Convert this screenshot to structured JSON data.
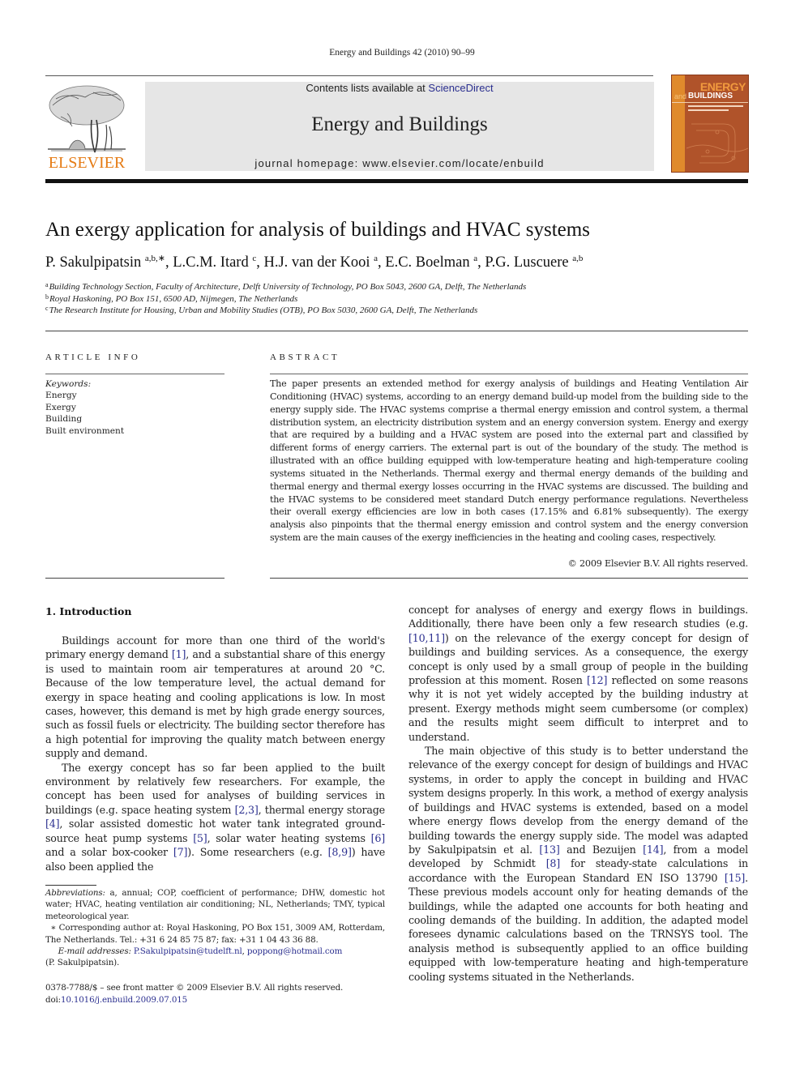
{
  "running_head": "Energy and Buildings 42 (2010) 90–99",
  "masthead": {
    "publisher_logo_text": "ELSEVIER",
    "contents_prefix": "Contents lists available at ",
    "contents_link": "ScienceDirect",
    "journal_name": "Energy and Buildings",
    "homepage_line": "journal homepage: www.elsevier.com/locate/enbuild",
    "cover": {
      "title_top": "ENERGY",
      "title_and": "and",
      "title_bottom": "BUILDINGS",
      "colors": {
        "background": "#b0532a",
        "stripe": "#e08a2c",
        "title": "#f19a3e"
      }
    },
    "colors": {
      "elsevier_orange": "#e57b14",
      "box_gray": "#e6e6e6",
      "link_blue": "#2b2f8f"
    }
  },
  "article": {
    "title": "An exergy application for analysis of buildings and HVAC systems",
    "authors": [
      {
        "name": "P. Sakulpipatsin",
        "sup": "a,b,∗"
      },
      {
        "name": "L.C.M. Itard",
        "sup": "c"
      },
      {
        "name": "H.J. van der Kooi",
        "sup": "a"
      },
      {
        "name": "E.C. Boelman",
        "sup": "a"
      },
      {
        "name": "P.G. Luscuere",
        "sup": "a,b"
      }
    ],
    "author_separator": ", ",
    "affiliations": [
      {
        "key": "a",
        "text": "Building Technology Section, Faculty of Architecture, Delft University of Technology, PO Box 5043, 2600 GA, Delft, The Netherlands"
      },
      {
        "key": "b",
        "text": "Royal Haskoning, PO Box 151, 6500 AD, Nijmegen, The Netherlands"
      },
      {
        "key": "c",
        "text": "The Research Institute for Housing, Urban and Mobility Studies (OTB), PO Box 5030, 2600 GA, Delft, The Netherlands"
      }
    ]
  },
  "article_info": {
    "heading": "ARTICLE INFO",
    "keywords_label": "Keywords:",
    "keywords": [
      "Energy",
      "Exergy",
      "Building",
      "Built environment"
    ]
  },
  "abstract": {
    "heading": "ABSTRACT",
    "text": "The paper presents an extended method for exergy analysis of buildings and Heating Ventilation Air Conditioning (HVAC) systems, according to an energy demand build-up model from the building side to the energy supply side. The HVAC systems comprise a thermal energy emission and control system, a thermal distribution system, an electricity distribution system and an energy conversion system. Energy and exergy that are required by a building and a HVAC system are posed into the external part and classified by different forms of energy carriers. The external part is out of the boundary of the study. The method is illustrated with an office building equipped with low-temperature heating and high-temperature cooling systems situated in the Netherlands. Thermal exergy and thermal energy demands of the building and thermal energy and thermal exergy losses occurring in the HVAC systems are discussed. The building and the HVAC systems to be considered meet standard Dutch energy performance regulations. Nevertheless their overall exergy efficiencies are low in both cases (17.15% and 6.81% subsequently). The exergy analysis also pinpoints that the thermal energy emission and control system and the energy conversion system are the main causes of the exergy inefficiencies in the heating and cooling cases, respectively.",
    "copyright": "© 2009 Elsevier B.V. All rights reserved."
  },
  "introduction": {
    "heading": "1.  Introduction",
    "paragraphs": [
      {
        "parts": [
          {
            "t": "Buildings account for more than one third of the world's primary energy demand "
          },
          {
            "ref": "[1]"
          },
          {
            "t": ", and a substantial share of this energy is used to maintain room air temperatures at around 20 °C. Because of the low temperature level, the actual demand for exergy in space heating and cooling applications is low. In most cases, however, this demand is met by high grade energy sources, such as fossil fuels or electricity. The building sector therefore has a high potential for improving the quality match between energy supply and demand."
          }
        ]
      },
      {
        "parts": [
          {
            "t": "The exergy concept has so far been applied to the built environment by relatively few researchers. For example, the concept has been used for analyses of building services in buildings (e.g. space heating system "
          },
          {
            "ref": "[2,3]"
          },
          {
            "t": ", thermal energy storage "
          },
          {
            "ref": "[4]"
          },
          {
            "t": ", solar assisted domestic hot water tank integrated ground-source heat pump systems "
          },
          {
            "ref": "[5]"
          },
          {
            "t": ", solar water heating systems "
          },
          {
            "ref": "[6]"
          },
          {
            "t": " and a solar box-cooker "
          },
          {
            "ref": "[7]"
          },
          {
            "t": "). Some researchers (e.g. "
          },
          {
            "ref": "[8,9]"
          },
          {
            "t": ") have also been applied the "
          }
        ]
      }
    ],
    "right_column": [
      {
        "continuation": true,
        "parts": [
          {
            "t": "concept for analyses of energy and exergy flows in buildings. Additionally, there have been only a few research studies (e.g. "
          },
          {
            "ref": "[10,11]"
          },
          {
            "t": ") on the relevance of the exergy concept for design of buildings and building services. As a consequence, the exergy concept is only used by a small group of people in the building profession at this moment. Rosen "
          },
          {
            "ref": "[12]"
          },
          {
            "t": " reflected on some reasons why it is not yet widely accepted by the building industry at present. Exergy methods might seem cumbersome (or complex) and the results might seem difficult to interpret and to understand."
          }
        ]
      },
      {
        "parts": [
          {
            "t": "The main objective of this study is to better understand the relevance of the exergy concept for design of buildings and HVAC systems, in order to apply the concept in building and HVAC system designs properly. In this work, a method of exergy analysis of buildings and HVAC systems is extended, based on a model where energy flows develop from the energy demand of the building towards the energy supply side. The model was adapted by Sakulpipatsin et al. "
          },
          {
            "ref": "[13]"
          },
          {
            "t": " and Bezuijen "
          },
          {
            "ref": "[14]"
          },
          {
            "t": ", from a model developed by Schmidt "
          },
          {
            "ref": "[8]"
          },
          {
            "t": " for steady-state calculations in accordance with the European Standard EN ISO 13790 "
          },
          {
            "ref": "[15]"
          },
          {
            "t": ". These previous models account only for heating demands of the buildings, while the adapted one accounts for both heating and cooling demands of the building. In addition, the adapted model foresees dynamic calculations based on the TRNSYS tool. The analysis method is subsequently applied to an office building equipped with low-temperature heating and high-temperature cooling systems situated in the Netherlands."
          }
        ]
      }
    ]
  },
  "footnotes": {
    "abbreviations_label": "Abbreviations:",
    "abbreviations_text": " a, annual; COP, coefficient of performance; DHW, domestic hot water; HVAC, heating ventilation air conditioning; NL, Netherlands; TMY, typical meteorological year.",
    "corresponding_mark": "∗",
    "corresponding_text": " Corresponding author at: Royal Haskoning, PO Box 151, 3009 AM, Rotterdam, The Netherlands. Tel.: +31 6 24 85 75 87; fax: +31 1 04 43 36 88.",
    "email_label": "E-mail addresses:",
    "emails": [
      "P.Sakulpipatsin@tudelft.nl",
      "poppong@hotmail.com"
    ],
    "email_owner": "(P. Sakulpipatsin)."
  },
  "issn": {
    "line": "0378-7788/$ – see front matter © 2009 Elsevier B.V. All rights reserved.",
    "doi_prefix": "doi:",
    "doi": "10.1016/j.enbuild.2009.07.015"
  }
}
